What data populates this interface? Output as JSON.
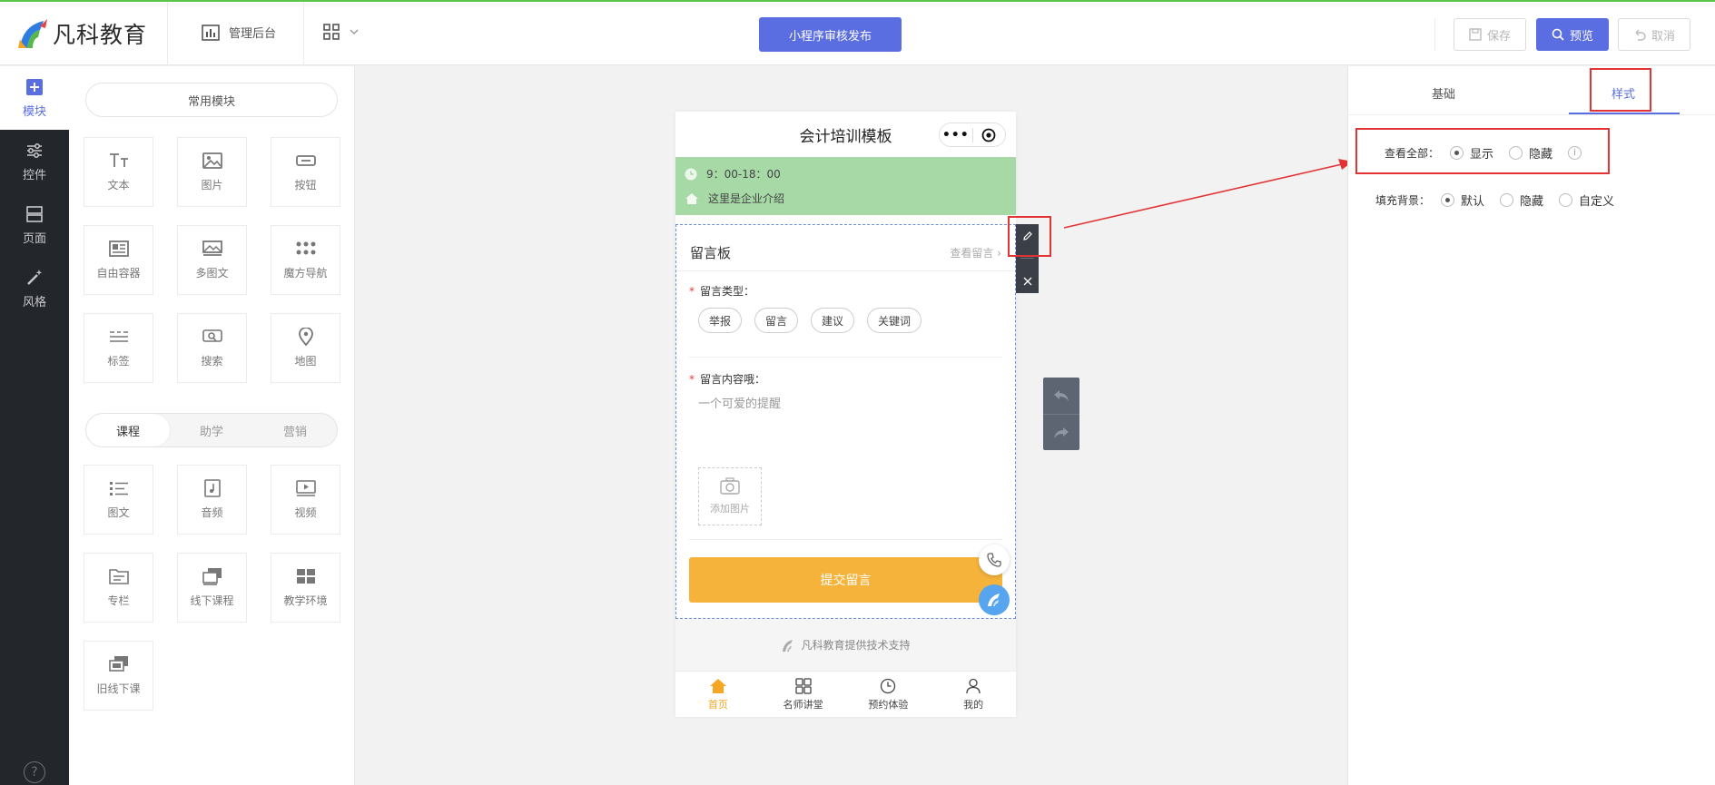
{
  "header": {
    "brand": "凡科教育",
    "admin_label": "管理后台",
    "publish_label": "小程序审核发布",
    "save_label": "保存",
    "preview_label": "预览",
    "cancel_label": "取消"
  },
  "left_nav": {
    "items": [
      {
        "label": "模块",
        "icon": "plus-square-icon"
      },
      {
        "label": "控件",
        "icon": "sliders-icon"
      },
      {
        "label": "页面",
        "icon": "pages-icon"
      },
      {
        "label": "风格",
        "icon": "magic-wand-icon"
      }
    ],
    "help": "?"
  },
  "modules": {
    "common_label": "常用模块",
    "common": [
      {
        "label": "文本",
        "icon": "text-icon"
      },
      {
        "label": "图片",
        "icon": "image-icon"
      },
      {
        "label": "按钮",
        "icon": "button-icon"
      },
      {
        "label": "自由容器",
        "icon": "container-icon"
      },
      {
        "label": "多图文",
        "icon": "multi-image-icon"
      },
      {
        "label": "魔方导航",
        "icon": "grid-dots-icon"
      },
      {
        "label": "标签",
        "icon": "tag-icon"
      },
      {
        "label": "搜索",
        "icon": "search-icon"
      },
      {
        "label": "地图",
        "icon": "map-pin-icon"
      }
    ],
    "tabs": [
      "课程",
      "助学",
      "营销"
    ],
    "course": [
      {
        "label": "图文",
        "icon": "list-icon"
      },
      {
        "label": "音频",
        "icon": "music-icon"
      },
      {
        "label": "视频",
        "icon": "video-icon"
      },
      {
        "label": "专栏",
        "icon": "folder-icon"
      },
      {
        "label": "线下课程",
        "icon": "offline-course-icon"
      },
      {
        "label": "教学环境",
        "icon": "classroom-icon"
      },
      {
        "label": "旧线下课",
        "icon": "old-course-icon"
      }
    ]
  },
  "phone": {
    "title": "会计培训模板",
    "hours": "9：00-18：00",
    "intro": "这里是企业介绍",
    "board_title": "留言板",
    "board_link": "查看留言",
    "type_label": "留言类型：",
    "chips": [
      "举报",
      "留言",
      "建议",
      "关键词"
    ],
    "content_label": "留言内容哦：",
    "placeholder": "一个可爱的提醒",
    "upload_label": "添加图片",
    "submit_label": "提交留言",
    "support": "凡科教育提供技术支持",
    "tabbar": [
      "首页",
      "名师讲堂",
      "预约体验",
      "我的"
    ]
  },
  "props": {
    "tabs": [
      "基础",
      "样式"
    ],
    "view_all_label": "查看全部：",
    "view_all_options": [
      "显示",
      "隐藏"
    ],
    "fill_bg_label": "填充背景：",
    "fill_bg_options": [
      "默认",
      "隐藏",
      "自定义"
    ]
  },
  "colors": {
    "accent": "#5b6ee1",
    "submit": "#f5b33c",
    "green_bar": "#a6d9a5",
    "highlight": "#e23434",
    "tab_active": "#f5a623"
  }
}
